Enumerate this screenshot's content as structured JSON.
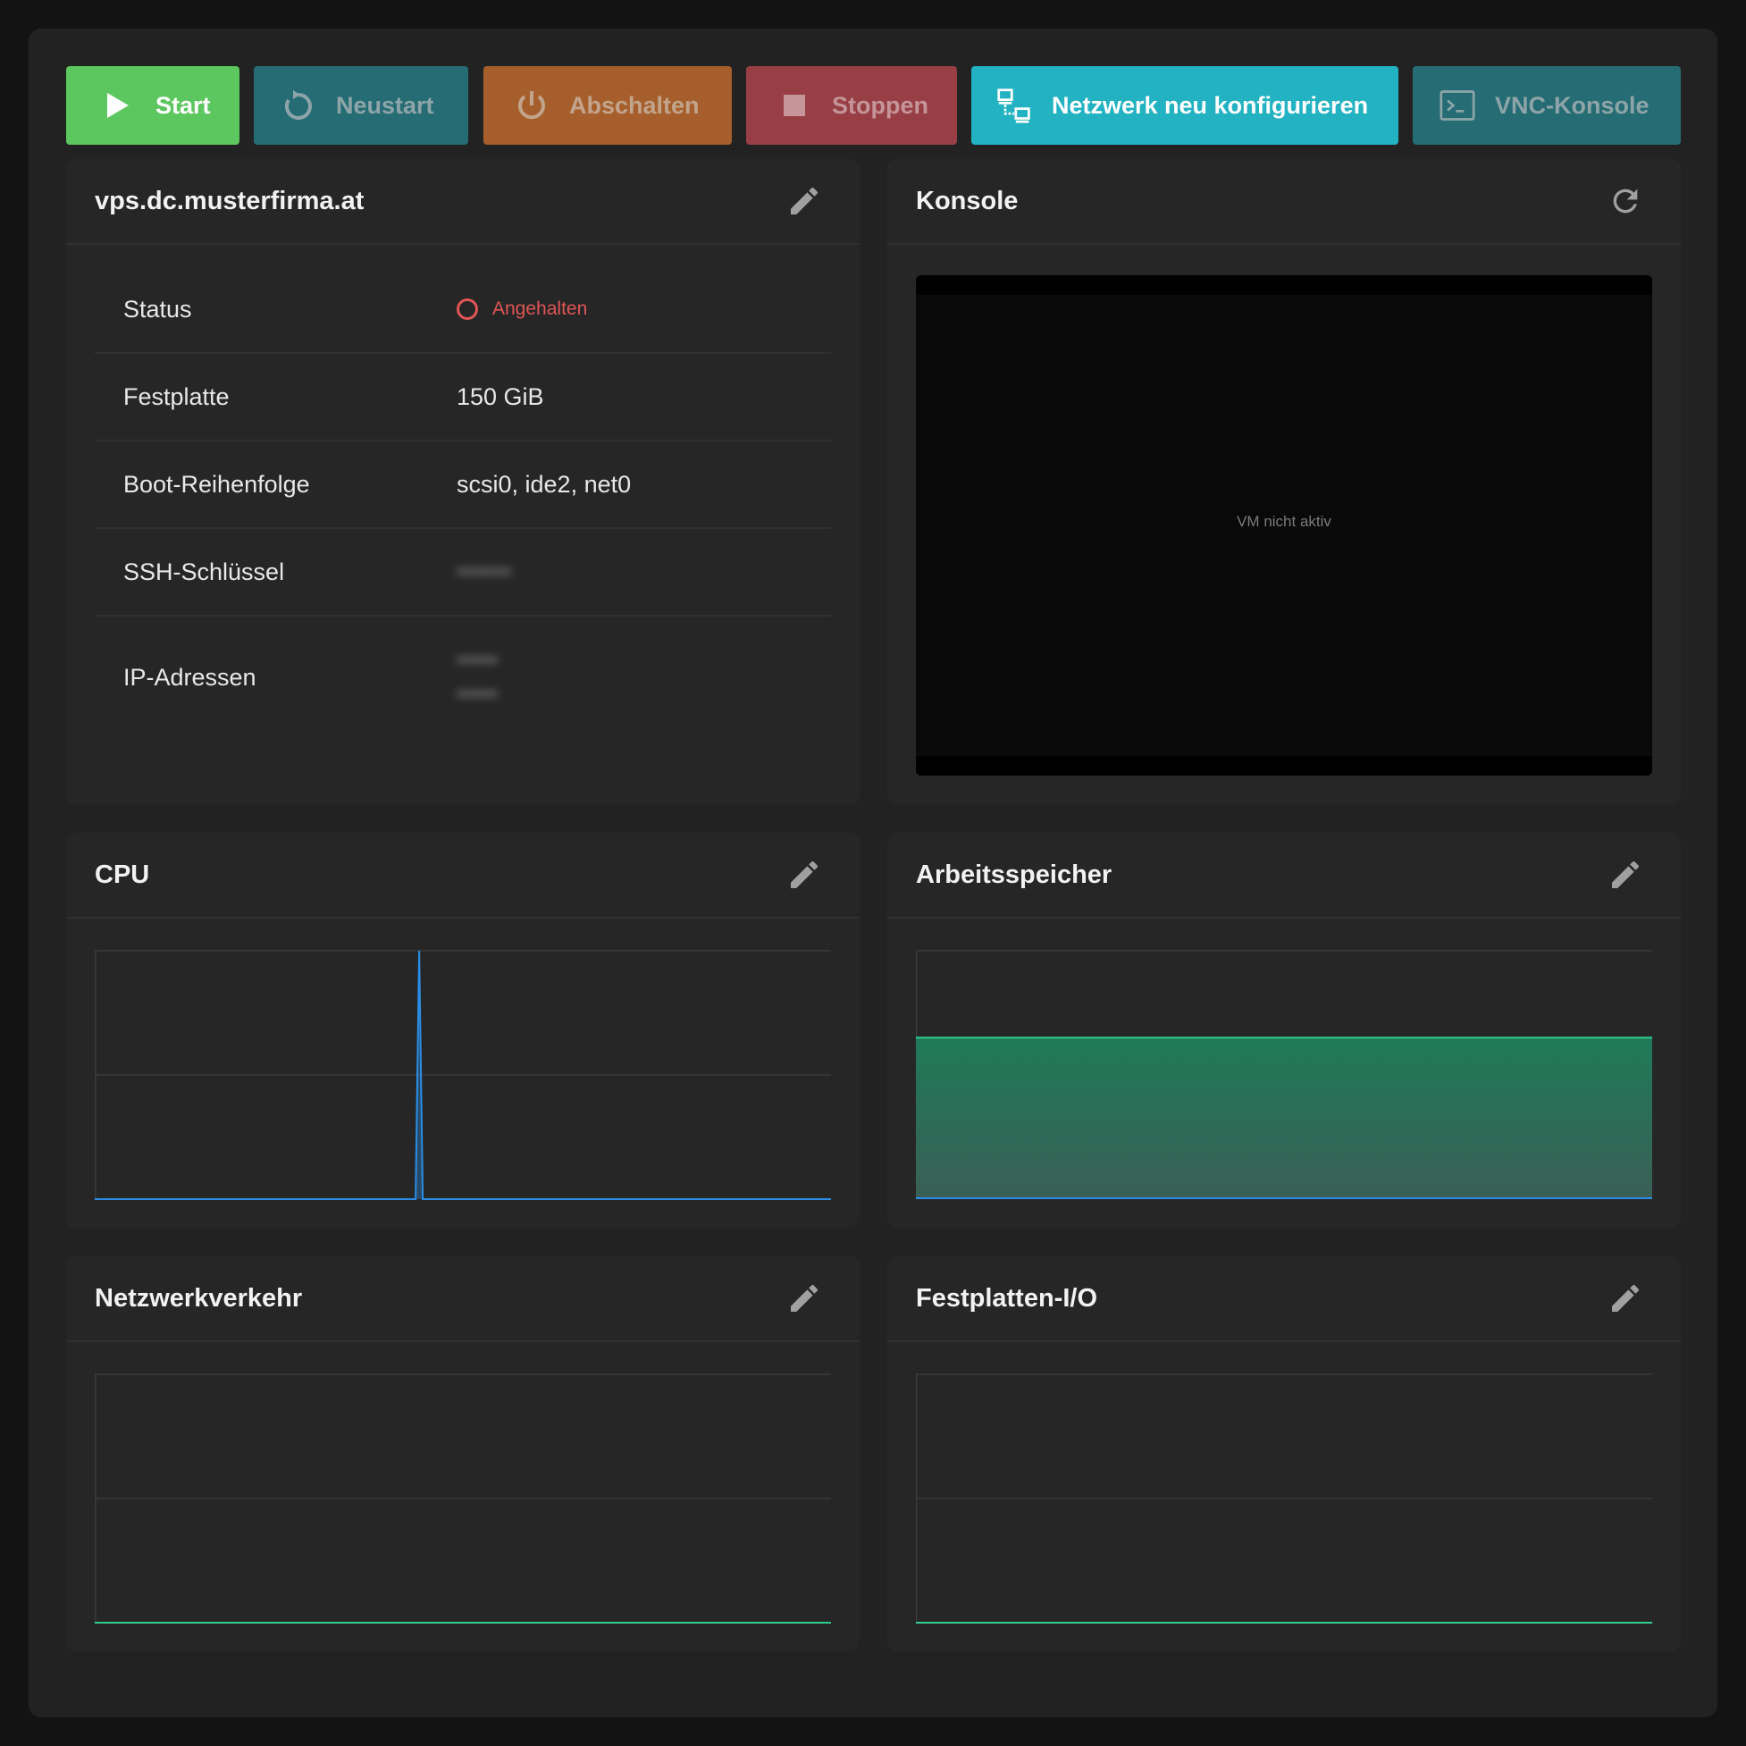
{
  "toolbar": {
    "start_label": "Start",
    "restart_label": "Neustart",
    "shutdown_label": "Abschalten",
    "stop_label": "Stoppen",
    "network_label": "Netzwerk neu konfigurieren",
    "vnc_label": "VNC-Konsole"
  },
  "info": {
    "title": "vps.dc.musterfirma.at",
    "rows": [
      {
        "label": "Status",
        "value": "Angehalten"
      },
      {
        "label": "Festplatte",
        "value": "150 GiB"
      },
      {
        "label": "Boot-Reihenfolge",
        "value": "scsi0, ide2, net0"
      },
      {
        "label": "SSH-Schlüssel",
        "value": "••••••••"
      },
      {
        "label": "IP-Adressen",
        "value": "••••••",
        "value2": "••••••"
      }
    ]
  },
  "console": {
    "title": "Konsole",
    "message": "VM nicht aktiv"
  },
  "charts": {
    "cpu": {
      "title": "CPU"
    },
    "memory": {
      "title": "Arbeitsspeicher"
    },
    "network": {
      "title": "Netzwerkverkehr"
    },
    "disk": {
      "title": "Festplatten-I/O"
    }
  },
  "chart_data": [
    {
      "type": "line",
      "title": "CPU",
      "values": [
        0,
        0,
        0,
        0,
        0,
        0,
        0,
        0,
        0,
        0,
        0,
        0,
        0,
        0,
        0,
        0,
        0,
        0,
        0,
        0,
        0,
        0,
        0,
        0,
        0,
        0,
        1,
        0,
        0,
        0,
        0,
        0,
        0,
        0,
        0,
        0,
        0,
        0,
        0,
        0,
        0,
        0,
        0,
        0,
        0,
        0,
        0,
        0,
        0,
        0,
        0,
        0,
        0,
        0,
        0,
        0,
        0,
        0,
        0,
        0
      ],
      "ylim": [
        0,
        1
      ],
      "color": "#2b8ee6",
      "grid": true
    },
    {
      "type": "area",
      "title": "Arbeitsspeicher",
      "values": [
        0.65,
        0.65,
        0.65,
        0.65,
        0.65,
        0.65,
        0.65,
        0.65,
        0.65,
        0.65,
        0.65,
        0.65,
        0.65,
        0.65,
        0.65,
        0.65,
        0.65,
        0.65,
        0.65,
        0.65
      ],
      "ylim": [
        0,
        1
      ],
      "color": "#2ecc8f",
      "grid": true
    },
    {
      "type": "line",
      "title": "Netzwerkverkehr",
      "values": [
        0,
        0,
        0,
        0,
        0,
        0,
        0,
        0,
        0,
        0,
        0,
        0,
        0,
        0,
        0,
        0,
        0,
        0,
        0,
        0
      ],
      "ylim": [
        0,
        1
      ],
      "color": "#2ecc8f",
      "grid": true
    },
    {
      "type": "line",
      "title": "Festplatten-I/O",
      "values": [
        0,
        0,
        0,
        0,
        0,
        0,
        0,
        0,
        0,
        0,
        0,
        0,
        0,
        0,
        0,
        0,
        0,
        0,
        0,
        0
      ],
      "ylim": [
        0,
        1
      ],
      "color": "#2ecc8f",
      "grid": true
    }
  ]
}
